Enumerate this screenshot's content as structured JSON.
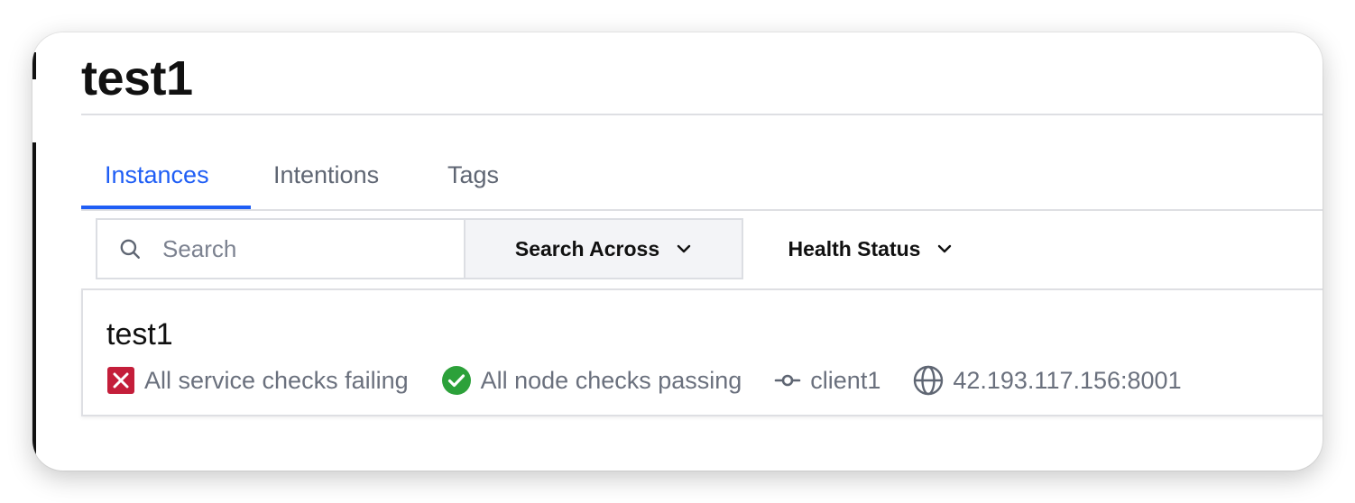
{
  "page": {
    "title": "test1"
  },
  "tabs": [
    {
      "label": "Instances",
      "active": true
    },
    {
      "label": "Intentions",
      "active": false
    },
    {
      "label": "Tags",
      "active": false
    }
  ],
  "search": {
    "placeholder": "Search",
    "value": "",
    "icon": "search-icon"
  },
  "filters": {
    "search_across_label": "Search Across",
    "health_status_label": "Health Status",
    "icon": "chevron-down-icon"
  },
  "instances": [
    {
      "name": "test1",
      "service_checks": {
        "text": "All service checks failing",
        "status": "failing",
        "icon": "x-square-icon",
        "color": "#c41e3a"
      },
      "node_checks": {
        "text": "All node checks passing",
        "status": "passing",
        "icon": "check-circle-icon",
        "color": "#2ca13a"
      },
      "node": {
        "text": "client1",
        "icon": "node-icon"
      },
      "address": {
        "text": "42.193.117.156:8001",
        "icon": "globe-icon"
      }
    }
  ],
  "colors": {
    "accent": "#1f5ef5",
    "text": "#111111",
    "muted": "#6a707d",
    "border": "#dedfe3",
    "fail": "#c41e3a",
    "pass": "#2ca13a"
  }
}
